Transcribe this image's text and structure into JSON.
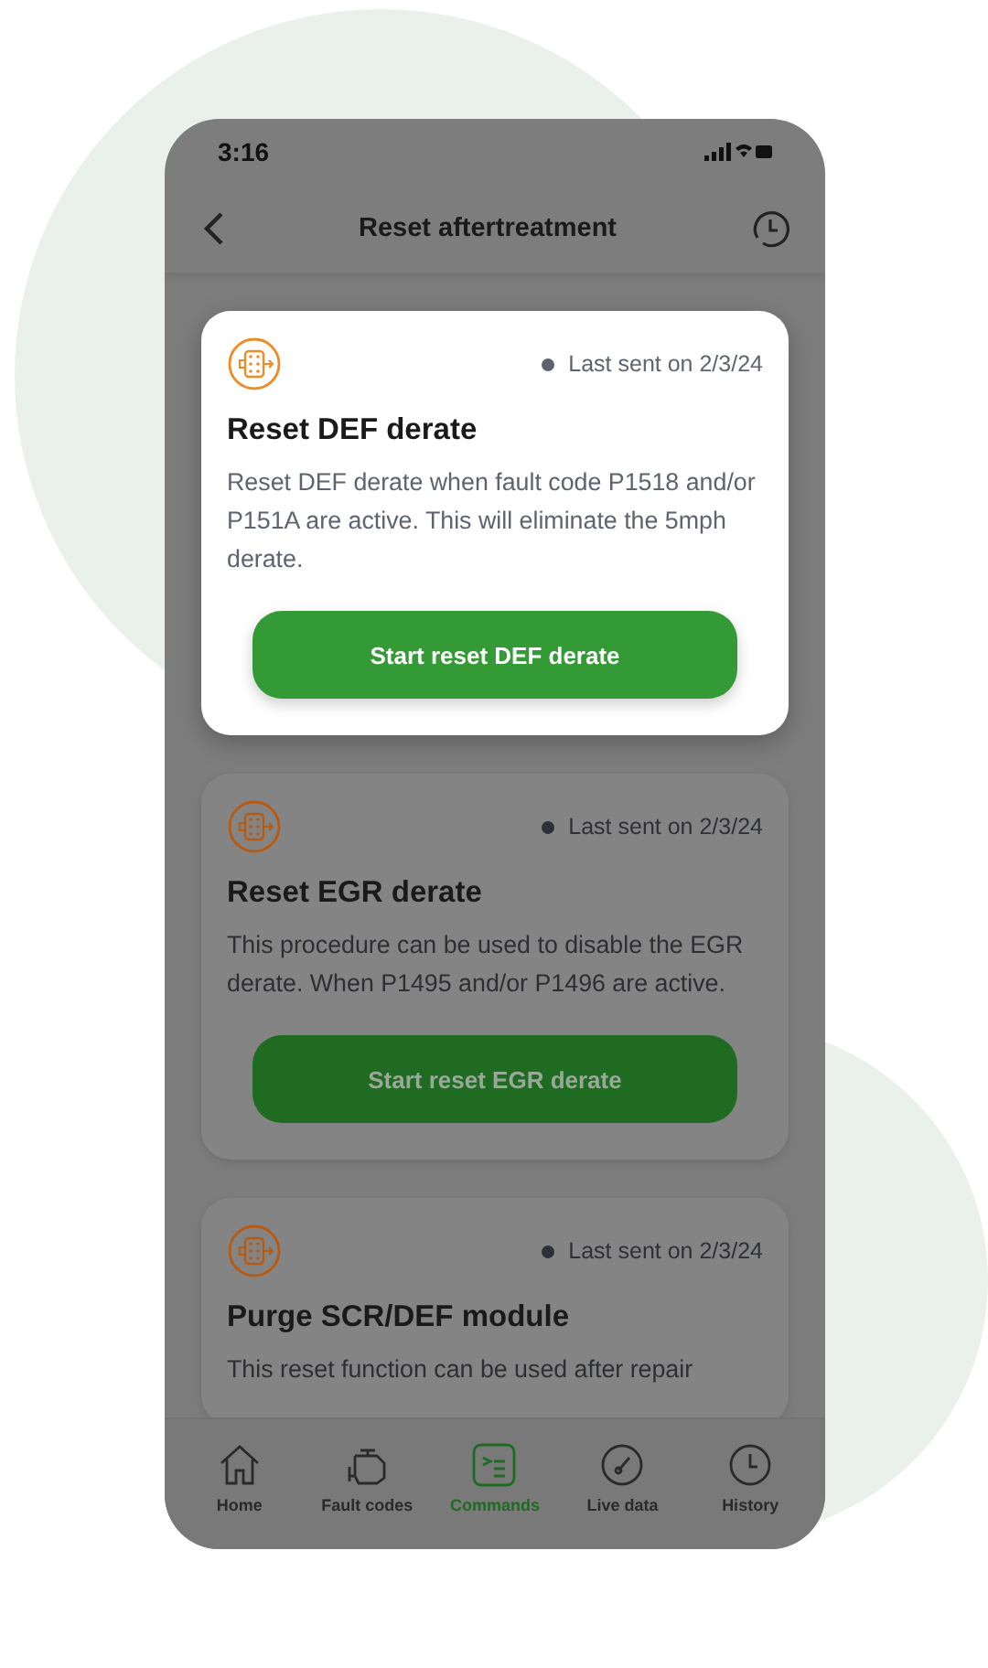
{
  "status_bar": {
    "time": "3:16"
  },
  "header": {
    "title": "Reset aftertreatment"
  },
  "cards": [
    {
      "highlighted": true,
      "last_sent": "Last sent on 2/3/24",
      "title": "Reset DEF derate",
      "description": "Reset DEF derate when fault code P1518 and/or P151A are active. This will eliminate the 5mph derate.",
      "button": "Start reset DEF derate"
    },
    {
      "highlighted": false,
      "last_sent": "Last sent on 2/3/24",
      "title": "Reset EGR derate",
      "description": "This procedure can be used to disable the EGR derate. When P1495 and/or P1496 are active.",
      "button": "Start reset EGR derate"
    },
    {
      "highlighted": false,
      "last_sent": "Last sent on 2/3/24",
      "title": "Purge SCR/DEF module",
      "description": "This reset function can be used after repair"
    }
  ],
  "nav": [
    {
      "kind": "home",
      "label": "Home",
      "selected": false
    },
    {
      "kind": "engine",
      "label": "Fault codes",
      "selected": false
    },
    {
      "kind": "commands",
      "label": "Commands",
      "selected": true
    },
    {
      "kind": "gauge",
      "label": "Live data",
      "selected": false
    },
    {
      "kind": "clock",
      "label": "History",
      "selected": false
    }
  ]
}
